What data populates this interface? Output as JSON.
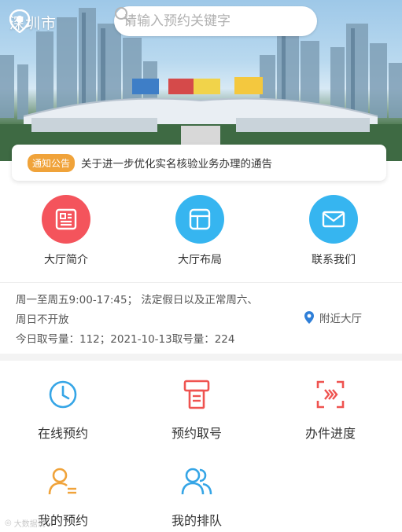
{
  "header": {
    "city": "深圳市",
    "search_placeholder": "请输入预约关键字"
  },
  "notice": {
    "tag": "通知公告",
    "text": "关于进一步优化实名核验业务办理的通告"
  },
  "shortcuts": [
    {
      "label": "大厅简介",
      "icon": "document-list-icon",
      "color": "#f4545c"
    },
    {
      "label": "大厅布局",
      "icon": "layout-icon",
      "color": "#36b5f0"
    },
    {
      "label": "联系我们",
      "icon": "mail-icon",
      "color": "#36b5f0"
    }
  ],
  "info": {
    "hours_line1": "周一至周五9:00-17:45； 法定假日以及正常周六、",
    "hours_line2": "周日不开放",
    "queue_line": "今日取号量：112；2021-10-13取号量：224",
    "nearby_label": "附近大厅"
  },
  "services": [
    {
      "label": "在线预约",
      "icon": "clock-icon",
      "color": "#35a5e6"
    },
    {
      "label": "预约取号",
      "icon": "ticket-machine-icon",
      "color": "#ef5350"
    },
    {
      "label": "办件进度",
      "icon": "scan-progress-icon",
      "color": "#ef5350"
    },
    {
      "label": "我的预约",
      "icon": "user-list-icon",
      "color": "#f0a33a"
    },
    {
      "label": "我的排队",
      "icon": "users-icon",
      "color": "#35a5e6"
    }
  ],
  "watermark": "大数据说"
}
